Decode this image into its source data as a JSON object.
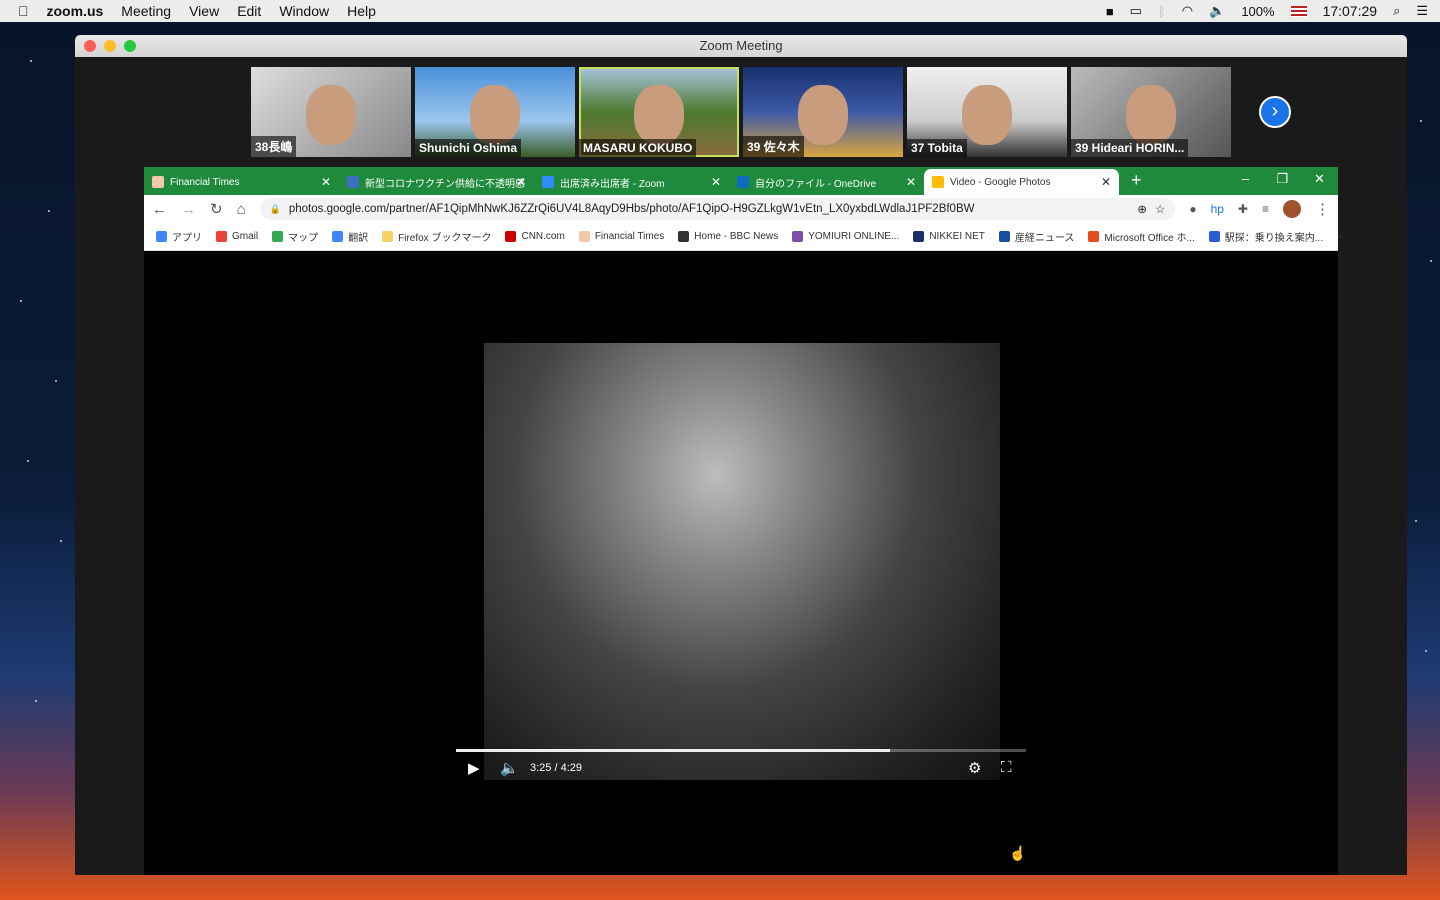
{
  "menubar": {
    "apple": "",
    "app": "zoom.us",
    "items": [
      "Meeting",
      "View",
      "Edit",
      "Window",
      "Help"
    ],
    "battery": "100%",
    "clock": "17:07:29"
  },
  "window": {
    "title": "Zoom Meeting"
  },
  "participants": [
    {
      "name": "38長嶋",
      "bg": "linear-gradient(135deg,#ddd,#888)"
    },
    {
      "name": "Shunichi Oshima",
      "bg": "linear-gradient(180deg,#4a90d9,#9cc6ee 60%,#3a5c2a)"
    },
    {
      "name": "MASARU KOKUBO",
      "bg": "linear-gradient(180deg,#aac4e0,#4d7a2e 50%,#8a6b3f)",
      "active": true
    },
    {
      "name": "39 佐々木",
      "bg": "linear-gradient(180deg,#17306e,#3d5aa8 50%,#d9a441)"
    },
    {
      "name": "37 Tobita",
      "bg": "linear-gradient(180deg,#f0f0f0,#ccc 60%,#333)"
    },
    {
      "name": "39 Hideari HORIN...",
      "bg": "linear-gradient(135deg,#bbb,#555)"
    }
  ],
  "browser": {
    "tabs": [
      {
        "label": "Financial Times",
        "color": "#f2c9a8"
      },
      {
        "label": "新型コロナワクチン供給に不透明感",
        "color": "#3b6fc4"
      },
      {
        "label": "出席済み出席者 - Zoom",
        "color": "#2d8cff"
      },
      {
        "label": "自分のファイル - OneDrive",
        "color": "#0f6cbd"
      },
      {
        "label": "Video - Google Photos",
        "color": "#fbbc04",
        "selected": true
      }
    ],
    "new_tab": "+",
    "url": "photos.google.com/partner/AF1QipMhNwKJ6ZZrQi6UV4L8AqyD9Hbs/photo/AF1QipO-H9GZLkgW1vEtn_LX0yxbdLWdlaJ1PF2Bf0BW",
    "bookmarks": [
      {
        "label": "アプリ",
        "color": "#4285f4"
      },
      {
        "label": "Gmail",
        "color": "#ea4335"
      },
      {
        "label": "マップ",
        "color": "#34a853"
      },
      {
        "label": "翻訳",
        "color": "#4285f4"
      },
      {
        "label": "Firefox ブックマーク",
        "color": "#f6d365"
      },
      {
        "label": "CNN.com",
        "color": "#cc0000"
      },
      {
        "label": "Financial Times",
        "color": "#f2c9a8"
      },
      {
        "label": "Home - BBC News",
        "color": "#333333"
      },
      {
        "label": "YOMIURI ONLINE...",
        "color": "#7b4fa8"
      },
      {
        "label": "NIKKEI NET",
        "color": "#1a2f6b"
      },
      {
        "label": "産経ニュース",
        "color": "#1a4fa0"
      },
      {
        "label": "Microsoft Office ホ...",
        "color": "#e8491d"
      },
      {
        "label": "駅探：乗り換え案内...",
        "color": "#2a5bd7"
      }
    ],
    "more": "»"
  },
  "player": {
    "time": "3:25 / 4:29",
    "progress": 0.762
  }
}
